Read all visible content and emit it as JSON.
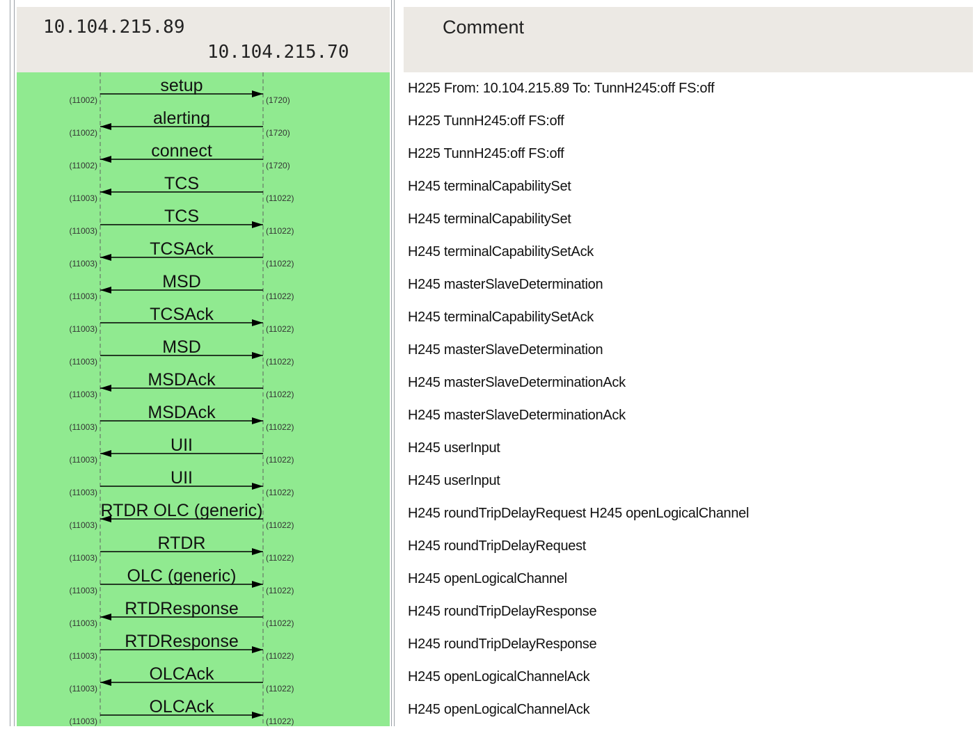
{
  "header": {
    "host_a": "10.104.215.89",
    "host_b": "10.104.215.70",
    "comment_title": "Comment"
  },
  "colors": {
    "flow_background": "#90ea90",
    "header_background": "#ece9e4",
    "arrow": "#000000"
  },
  "flows": [
    {
      "label": "setup",
      "dir": "right",
      "left_port": "11002",
      "right_port": "1720",
      "comment": "H225 From: 10.104.215.89 To:  TunnH245:off FS:off"
    },
    {
      "label": "alerting",
      "dir": "left",
      "left_port": "11002",
      "right_port": "1720",
      "comment": "H225 TunnH245:off FS:off"
    },
    {
      "label": "connect",
      "dir": "left",
      "left_port": "11002",
      "right_port": "1720",
      "comment": "H225 TunnH245:off FS:off"
    },
    {
      "label": "TCS",
      "dir": "left",
      "left_port": "11003",
      "right_port": "11022",
      "comment": "H245 terminalCapabilitySet"
    },
    {
      "label": "TCS",
      "dir": "right",
      "left_port": "11003",
      "right_port": "11022",
      "comment": "H245 terminalCapabilitySet"
    },
    {
      "label": "TCSAck",
      "dir": "left",
      "left_port": "11003",
      "right_port": "11022",
      "comment": "H245 terminalCapabilitySetAck"
    },
    {
      "label": "MSD",
      "dir": "left",
      "left_port": "11003",
      "right_port": "11022",
      "comment": "H245 masterSlaveDetermination"
    },
    {
      "label": "TCSAck",
      "dir": "right",
      "left_port": "11003",
      "right_port": "11022",
      "comment": "H245 terminalCapabilitySetAck"
    },
    {
      "label": "MSD",
      "dir": "right",
      "left_port": "11003",
      "right_port": "11022",
      "comment": "H245 masterSlaveDetermination"
    },
    {
      "label": "MSDAck",
      "dir": "left",
      "left_port": "11003",
      "right_port": "11022",
      "comment": "H245 masterSlaveDeterminationAck"
    },
    {
      "label": "MSDAck",
      "dir": "right",
      "left_port": "11003",
      "right_port": "11022",
      "comment": "H245 masterSlaveDeterminationAck"
    },
    {
      "label": "UII",
      "dir": "left",
      "left_port": "11003",
      "right_port": "11022",
      "comment": "H245 userInput"
    },
    {
      "label": "UII",
      "dir": "right",
      "left_port": "11003",
      "right_port": "11022",
      "comment": "H245 userInput"
    },
    {
      "label": "RTDR OLC (generic)",
      "dir": "left",
      "left_port": "11003",
      "right_port": "11022",
      "comment": "H245 roundTripDelayRequest H245 openLogicalChannel"
    },
    {
      "label": "RTDR",
      "dir": "right",
      "left_port": "11003",
      "right_port": "11022",
      "comment": "H245 roundTripDelayRequest"
    },
    {
      "label": "OLC (generic)",
      "dir": "right",
      "left_port": "11003",
      "right_port": "11022",
      "comment": "H245 openLogicalChannel"
    },
    {
      "label": "RTDResponse",
      "dir": "left",
      "left_port": "11003",
      "right_port": "11022",
      "comment": "H245 roundTripDelayResponse"
    },
    {
      "label": "RTDResponse",
      "dir": "right",
      "left_port": "11003",
      "right_port": "11022",
      "comment": "H245 roundTripDelayResponse"
    },
    {
      "label": "OLCAck",
      "dir": "left",
      "left_port": "11003",
      "right_port": "11022",
      "comment": "H245 openLogicalChannelAck"
    },
    {
      "label": "OLCAck",
      "dir": "right",
      "left_port": "11003",
      "right_port": "11022",
      "comment": "H245 openLogicalChannelAck"
    }
  ]
}
